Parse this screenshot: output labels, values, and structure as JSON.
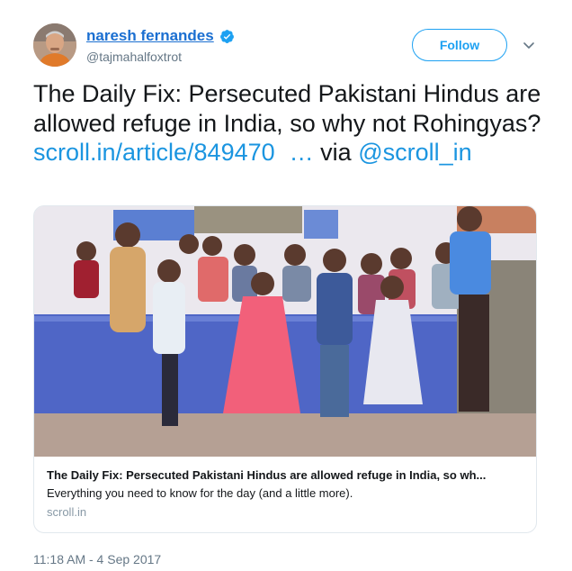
{
  "author": {
    "name": "naresh fernandes",
    "handle": "@tajmahalfoxtrot",
    "verified": true
  },
  "follow_button": {
    "label": "Follow"
  },
  "tweet": {
    "text_part1": "The Daily Fix: Persecuted Pakistani Hindus are allowed refuge in India, so why not Rohingyas?",
    "link": "scroll.in/article/849470",
    "ellipsis": "…",
    "via": "via",
    "mention": "@scroll_in"
  },
  "card": {
    "title": "The Daily Fix: Persecuted Pakistani Hindus are allowed refuge in India, so wh...",
    "description": "Everything you need to know for the day (and a little more).",
    "domain": "scroll.in"
  },
  "timestamp": "11:18 AM - 4 Sep 2017",
  "colors": {
    "link": "#1b95e0",
    "follow": "#1da1f2",
    "verified": "#1da1f2",
    "muted": "#657786"
  },
  "icons": [
    "verified-badge-icon",
    "chevron-down-icon"
  ]
}
